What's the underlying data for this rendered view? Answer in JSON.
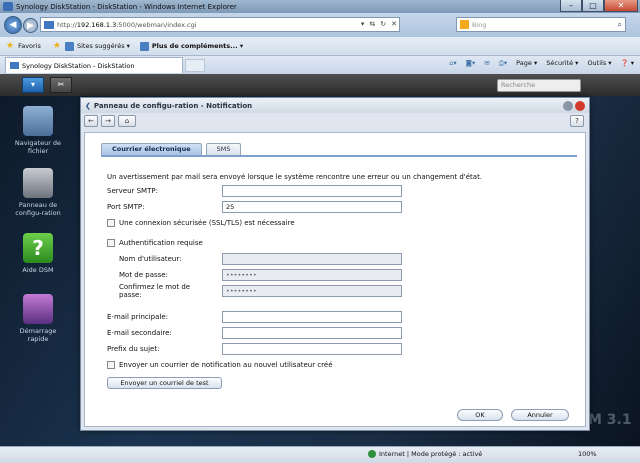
{
  "browser": {
    "window_title": "Synology DiskStation - DiskStation - Windows Internet Explorer",
    "address_prefix": "http://",
    "address_host": "192.168.1.3",
    "address_rest": ":5000/webman/index.cgi",
    "search_placeholder": "Bing",
    "favorites_label": "Favoris",
    "favorites_items": [
      "Sites suggérés ▾",
      "Plus de compléments... ▾"
    ],
    "tab_title": "Synology DiskStation - DiskStation",
    "commands": [
      "Page ▾",
      "Sécurité ▾",
      "Outils ▾",
      "❓ ▾"
    ],
    "status_zone": "Internet | Mode protégé : activé",
    "zoom": "100%"
  },
  "dsm": {
    "search_placeholder": "Recherche",
    "desktop_icons": [
      {
        "label": "Navigateur de fichier"
      },
      {
        "label": "Panneau de configu-ration"
      },
      {
        "label": "Aide DSM"
      },
      {
        "label": "Démarrage rapide"
      }
    ],
    "watermark": "M 3.1"
  },
  "dialog": {
    "title": "Panneau de configu-ration - Notification",
    "tabs": [
      "Courrier électronique",
      "SMS"
    ],
    "intro": "Un avertissement par mail sera envoyé lorsque le système rencontre une erreur ou un changement d'état.",
    "smtp_server_label": "Serveur SMTP:",
    "smtp_server_value": "",
    "smtp_port_label": "Port SMTP:",
    "smtp_port_value": "25",
    "ssl_label": "Une connexion sécurisée (SSL/TLS) est nécessaire",
    "auth_label": "Authentification requise",
    "username_label": "Nom d'utilisateur:",
    "password_label": "Mot de passe:",
    "password_value": "••••••••",
    "confirm_label": "Confirmez le mot de passe:",
    "confirm_value": "••••••••",
    "primary_email_label": "E-mail principale:",
    "secondary_email_label": "E-mail secondaire:",
    "subject_prefix_label": "Prefix du sujet:",
    "new_user_label": "Envoyer un courrier de notification au nouvel utilisateur créé",
    "test_button": "Envoyer un courriel de test",
    "ok_button": "OK",
    "cancel_button": "Annuler"
  }
}
